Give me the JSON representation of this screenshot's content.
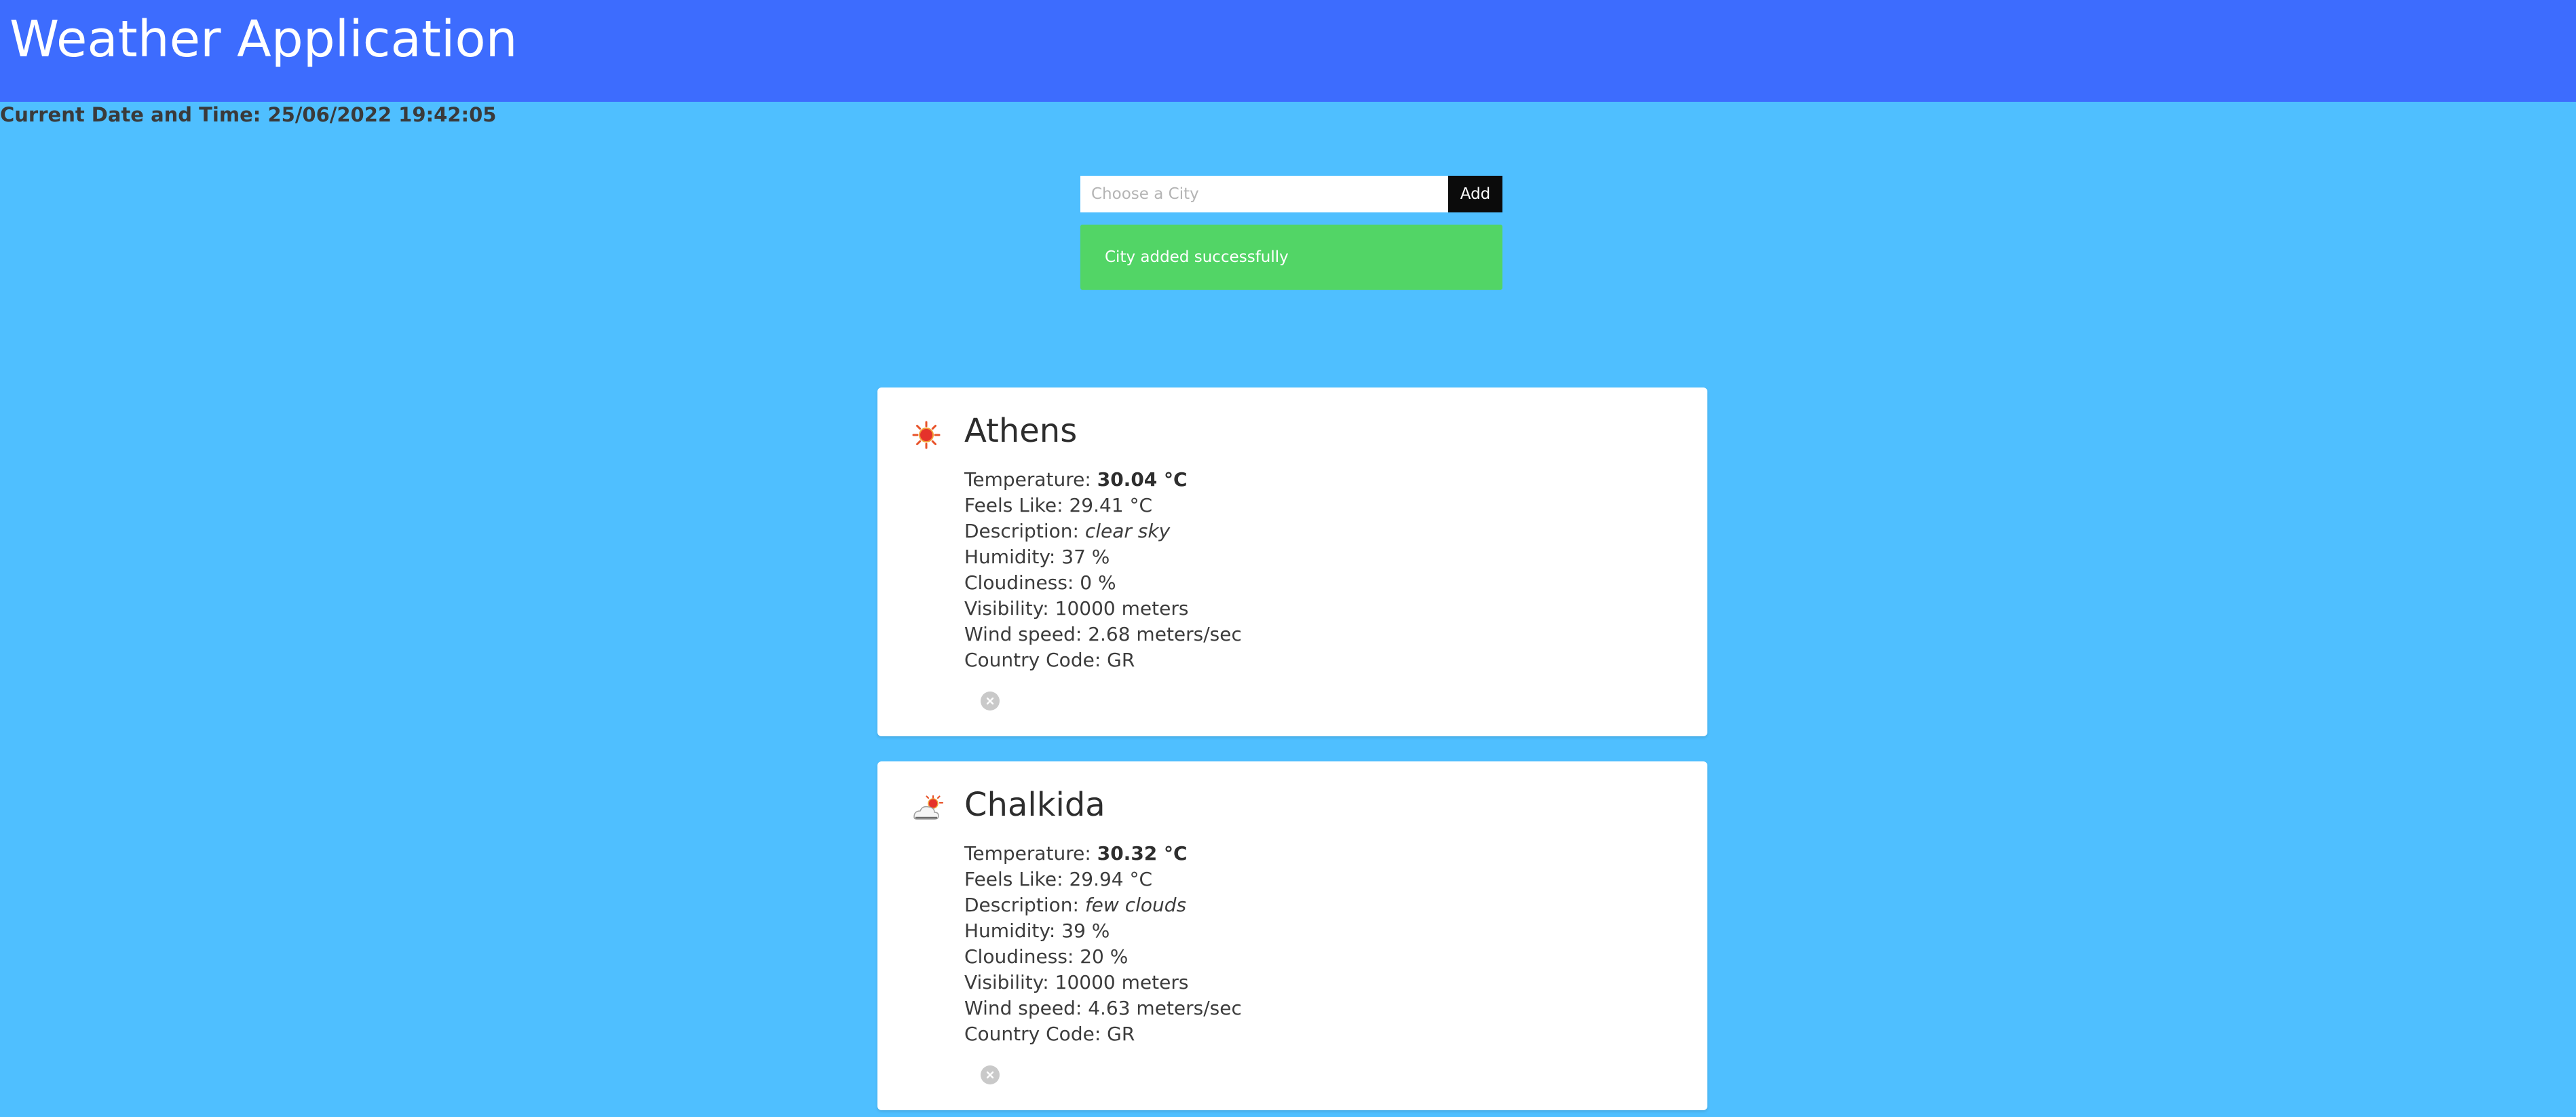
{
  "header": {
    "title": "Weather Application"
  },
  "datetime": {
    "label": "Current Date and Time:",
    "value": "25/06/2022 19:42:05"
  },
  "search": {
    "placeholder": "Choose a City",
    "value": "",
    "add_label": "Add"
  },
  "alert": {
    "message": "City added successfully",
    "color": "#52d566"
  },
  "colors": {
    "header_bg": "#3d6cfe",
    "page_bg": "#4fbfff",
    "button_bg": "#0b0b0b"
  },
  "cities": [
    {
      "name": "Athens",
      "icon": "sun-icon",
      "temperature_label": "Temperature:",
      "temperature": "30.04 °C",
      "feels_like": "Feels Like: 29.41 °C",
      "description_label": "Description:",
      "description": "clear sky",
      "humidity": "Humidity: 37 %",
      "cloudiness": "Cloudiness: 0 %",
      "visibility": "Visibility: 10000 meters",
      "wind_speed": "Wind speed: 2.68 meters/sec",
      "country_code": "Country Code: GR"
    },
    {
      "name": "Chalkida",
      "icon": "few-clouds-icon",
      "temperature_label": "Temperature:",
      "temperature": "30.32 °C",
      "feels_like": "Feels Like: 29.94 °C",
      "description_label": "Description:",
      "description": "few clouds",
      "humidity": "Humidity: 39 %",
      "cloudiness": "Cloudiness: 20 %",
      "visibility": "Visibility: 10000 meters",
      "wind_speed": "Wind speed: 4.63 meters/sec",
      "country_code": "Country Code: GR"
    }
  ]
}
